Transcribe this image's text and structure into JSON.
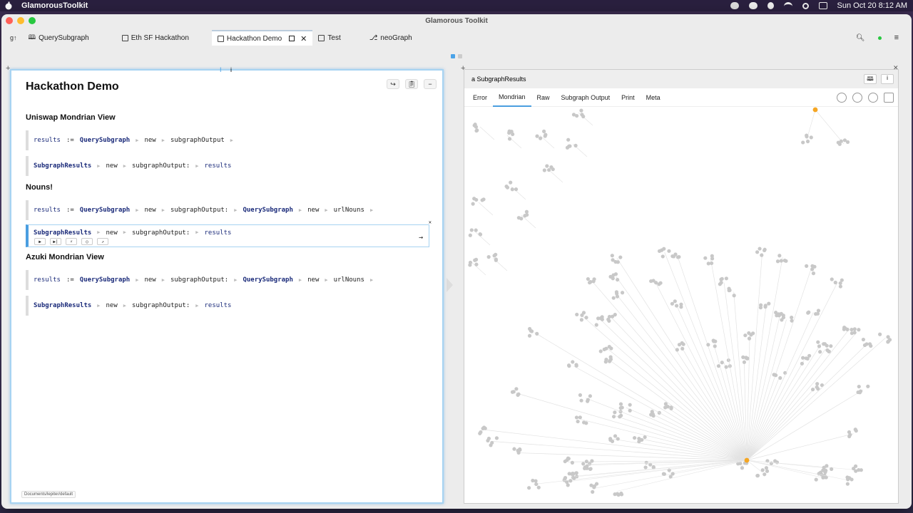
{
  "menubar": {
    "app_name": "GlamorousToolkit",
    "clock": "Sun Oct 20  8:12 AM"
  },
  "window": {
    "title": "Glamorous Toolkit"
  },
  "tabs": [
    {
      "label": "QuerySubgraph",
      "icon": "book-icon"
    },
    {
      "label": "Eth SF Hackathon",
      "icon": "page-icon"
    },
    {
      "label": "Hackathon Demo",
      "icon": "page-icon"
    },
    {
      "label": "Test",
      "icon": "page-icon"
    },
    {
      "label": "neoGraph",
      "icon": "branch-icon"
    }
  ],
  "left_pane": {
    "title": "Hackathon Demo",
    "sections": [
      {
        "heading": "Uniswap Mondrian View",
        "snippets": [
          [
            "results",
            ":=",
            "QuerySubgraph",
            "new",
            "subgraphOutput"
          ],
          [
            "SubgraphResults",
            "new",
            "subgraphOutput:",
            "results"
          ]
        ]
      },
      {
        "heading": "Nouns!",
        "snippets": [
          [
            "results",
            ":=",
            "QuerySubgraph",
            "new",
            "subgraphOutput:",
            "QuerySubgraph",
            "new",
            "urlNouns"
          ],
          [
            "SubgraphResults",
            "new",
            "subgraphOutput:",
            "results"
          ]
        ]
      },
      {
        "heading": "Azuki Mondrian View",
        "snippets": [
          [
            "results",
            ":=",
            "QuerySubgraph",
            "new",
            "subgraphOutput:",
            "QuerySubgraph",
            "new",
            "urlNouns"
          ],
          [
            "SubgraphResults",
            "new",
            "subgraphOutput:",
            "results"
          ]
        ]
      }
    ],
    "path_label": "Documents/lepiter/default"
  },
  "right_pane": {
    "title": "a SubgraphResults",
    "view_tabs": [
      "Error",
      "Mondrian",
      "Raw",
      "Subgraph Output",
      "Print",
      "Meta"
    ],
    "active_view_tab": "Mondrian"
  },
  "colors": {
    "accent": "#4a9ee0",
    "node": "#c8c8c8",
    "root_node": "#f5a623"
  }
}
